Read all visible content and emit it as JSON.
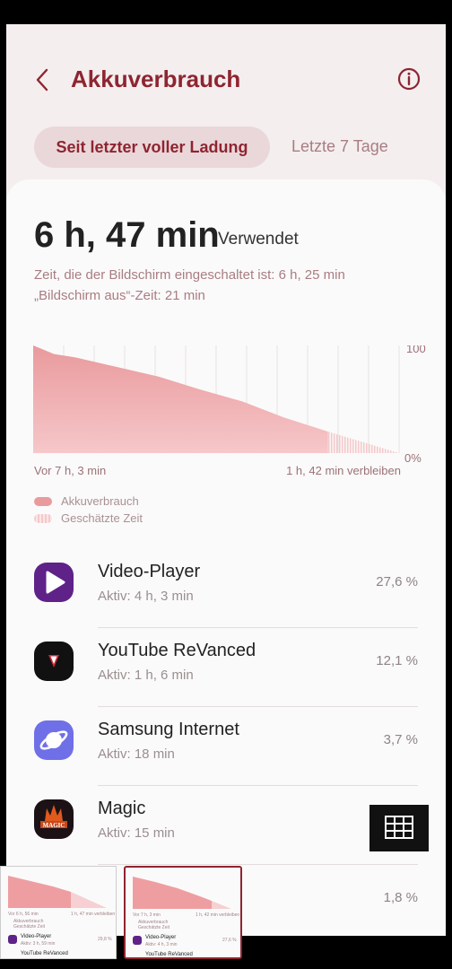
{
  "header": {
    "title": "Akkuverbrauch",
    "back_icon": "back-arrow-icon",
    "info_icon": "info-icon"
  },
  "segments": {
    "active": "Seit letzter voller Ladung",
    "inactive": "Letzte 7 Tage"
  },
  "summary": {
    "time": "6 h, 47 min",
    "label": "Verwendet",
    "screen_on": "Zeit, die der Bildschirm eingeschaltet ist: 6 h, 25 min",
    "screen_off": "„Bildschirm aus“-Zeit: 21 min"
  },
  "chart": {
    "start_label": "Vor 7 h, 3 min",
    "end_label": "1 h, 42 min verbleiben",
    "y_top": "100",
    "y_bottom": "0%",
    "legend_used": "Akkuverbrauch",
    "legend_estimated": "Geschätzte Zeit",
    "used_color": "#e99a9d",
    "estimate_color": "#f3c9cb"
  },
  "chart_data": {
    "type": "area",
    "ylim": [
      0,
      100
    ],
    "series": [
      {
        "name": "Akkuverbrauch",
        "x_hours": [
          0,
          0.5,
          1,
          2,
          3,
          4,
          5,
          6,
          7.05
        ],
        "values": [
          100,
          92,
          89,
          80,
          71,
          59,
          48,
          33,
          20
        ]
      },
      {
        "name": "Geschätzte Zeit",
        "x_hours": [
          7.05,
          8.75
        ],
        "values": [
          20,
          0
        ]
      }
    ]
  },
  "apps": [
    {
      "name": "Video-Player",
      "active": "Aktiv: 4 h, 3 min",
      "pct": "27,6 %"
    },
    {
      "name": "YouTube ReVanced",
      "active": "Aktiv: 1 h, 6 min",
      "pct": "12,1 %"
    },
    {
      "name": "Samsung Internet",
      "active": "Aktiv: 18 min",
      "pct": "3,7 %"
    },
    {
      "name": "Magic",
      "active": "Aktiv: 15 min",
      "pct": ""
    },
    {
      "name": "",
      "active": "",
      "pct": "1,8 %"
    }
  ],
  "thumbnails": {
    "t1_app": "Video-Player",
    "t1_active": "Aktiv: 3 h, 59 min",
    "t1_pct": "29,8 %",
    "t1_next": "YouTube ReVanced",
    "t2_app": "Video-Player",
    "t2_active": "Aktiv: 4 h, 3 min",
    "t2_pct": "27,6 %",
    "t2_next": "YouTube ReVanced",
    "t1_left": "Vor 6 h, 56 min",
    "t1_right": "1 h, 47 min verbleiben",
    "t2_left": "Vor 7 h, 3 min",
    "t2_right": "1 h, 42 min verbleiben",
    "legend_used": "Akkuverbrauch",
    "legend_estimated": "Geschätzte Zeit"
  }
}
